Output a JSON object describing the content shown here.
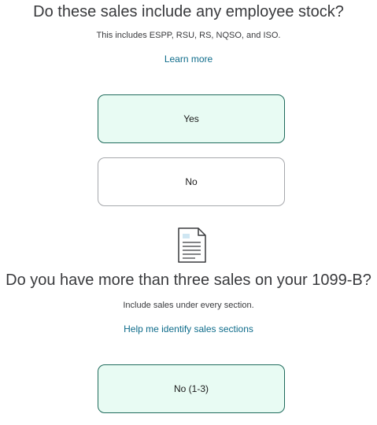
{
  "question1": {
    "title": "Do these sales include any employee stock?",
    "subtitle": "This includes ESPP, RSU, RS, NQSO, and ISO.",
    "link": "Learn more",
    "options": [
      {
        "label": "Yes",
        "selected": true
      },
      {
        "label": "No",
        "selected": false
      }
    ]
  },
  "document_icon": "document-icon",
  "question2": {
    "title": "Do you have more than three sales on your 1099-B?",
    "subtitle": "Include sales under every section.",
    "link": "Help me identify sales sections",
    "options": [
      {
        "label": "No (1-3)",
        "selected": true
      }
    ]
  },
  "colors": {
    "selected_bg": "#e8fbf3",
    "selected_border": "#1f6b5c",
    "link": "#0d6b8a",
    "text": "#393a3d"
  }
}
